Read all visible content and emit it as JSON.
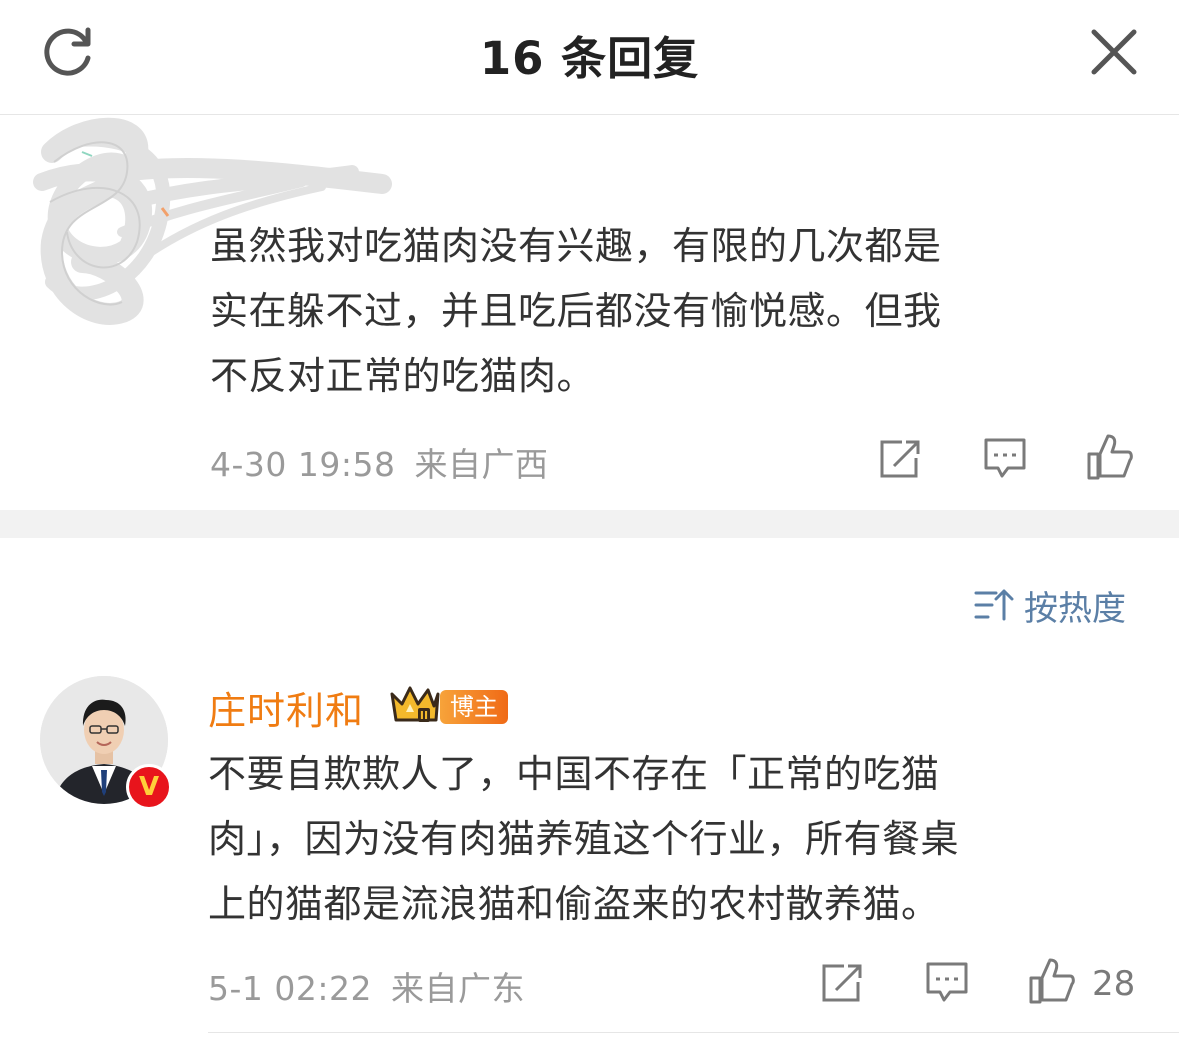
{
  "header": {
    "title": "16 条回复",
    "refresh_icon": "refresh-icon",
    "close_icon": "close-icon"
  },
  "root_comment": {
    "text_lines": [
      "虽然我对吃猫肉没有兴趣，有限的几次都是",
      "实在躲不过，并且吃后都没有愉悦感。但我",
      "不反对正常的吃猫肉。"
    ],
    "time": "4-30 19:58",
    "location": "来自广西",
    "actions": [
      "share-icon",
      "comment-icon",
      "like-icon"
    ]
  },
  "sort": {
    "label": "按热度",
    "icon": "sort-icon",
    "accent": "#5b7fa6"
  },
  "reply": {
    "username": "庄时利和",
    "username_color": "#f07c12",
    "badge": "博主",
    "crown_level": "II",
    "verified_mark": "V",
    "text_lines": [
      "不要自欺欺人了，中国不存在「正常的吃猫",
      "肉」，因为没有肉猫养殖这个行业，所有餐桌",
      "上的猫都是流浪猫和偷盗来的农村散养猫。"
    ],
    "time": "5-1 02:22",
    "location": "来自广东",
    "like_count": "28",
    "actions": [
      "share-icon",
      "comment-icon",
      "like-icon"
    ]
  }
}
